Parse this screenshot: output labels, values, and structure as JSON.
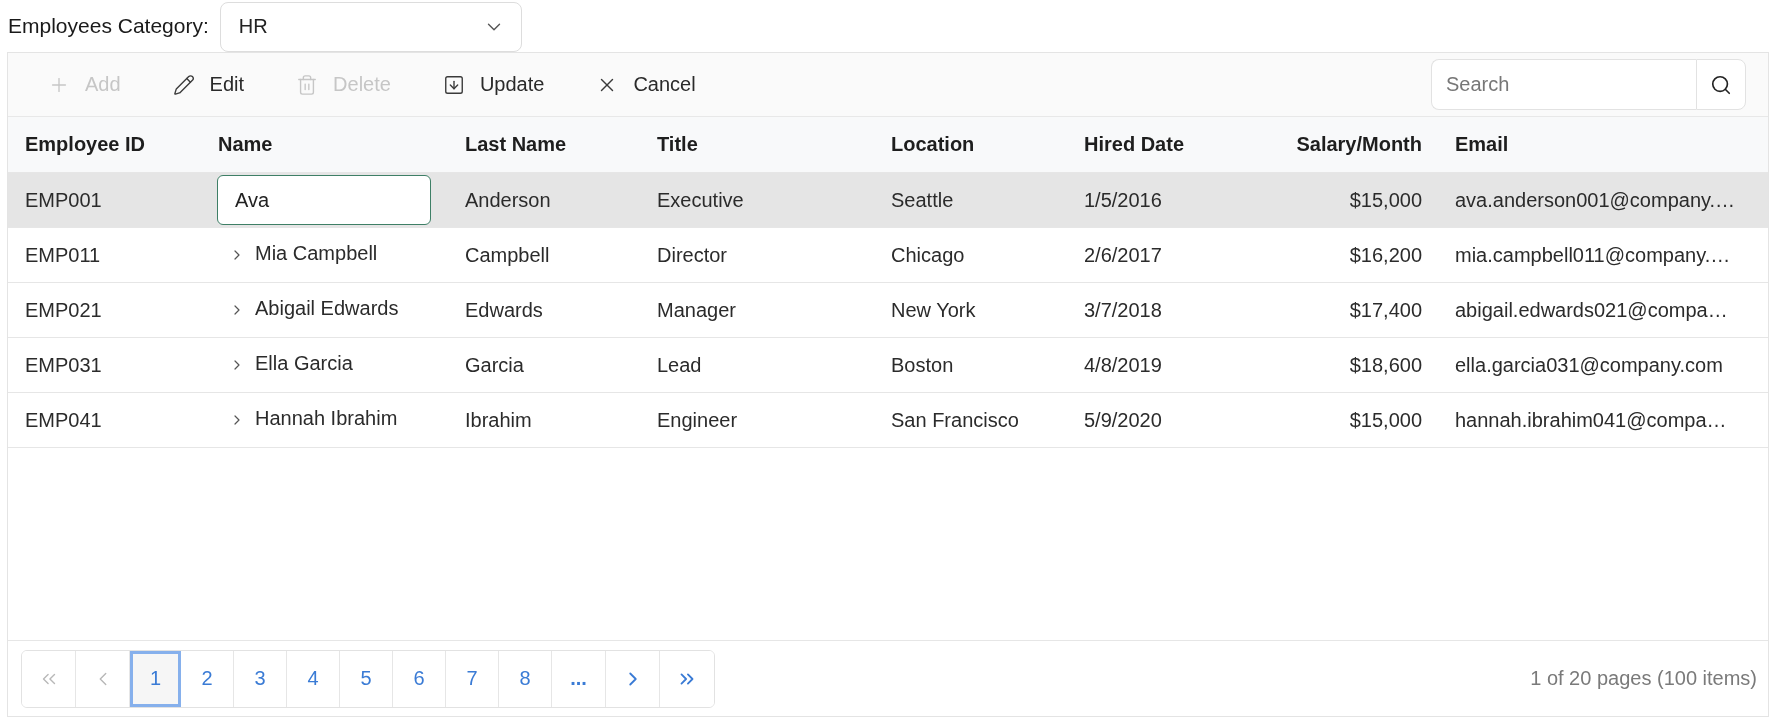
{
  "filter": {
    "label": "Employees Category:",
    "value": "HR"
  },
  "toolbar": {
    "items": [
      {
        "kind": "add",
        "label": "Add",
        "disabled": true
      },
      {
        "kind": "edit",
        "label": "Edit",
        "disabled": false
      },
      {
        "kind": "delete",
        "label": "Delete",
        "disabled": true
      },
      {
        "kind": "update",
        "label": "Update",
        "disabled": false
      },
      {
        "kind": "cancel",
        "label": "Cancel",
        "disabled": false
      }
    ],
    "search": {
      "placeholder": "Search"
    }
  },
  "table": {
    "columns": [
      {
        "label": "Employee ID",
        "kind": "text"
      },
      {
        "label": "Name",
        "kind": "text"
      },
      {
        "label": "Last Name",
        "kind": "text"
      },
      {
        "label": "Title",
        "kind": "text"
      },
      {
        "label": "Location",
        "kind": "text"
      },
      {
        "label": "Hired Date",
        "kind": "text"
      },
      {
        "label": "Salary/Month",
        "kind": "number"
      },
      {
        "label": "Email",
        "kind": "text"
      }
    ],
    "rows": [
      {
        "selected": true,
        "cells": [
          "EMP001",
          {
            "kind": "input",
            "value": "Ava"
          },
          "Anderson",
          "Executive",
          "Seattle",
          "1/5/2016",
          "$15,000",
          "ava.anderson001@company.…"
        ]
      },
      {
        "selected": false,
        "cells": [
          "EMP011",
          {
            "kind": "expander",
            "text": "Mia Campbell",
            "expanded": false
          },
          "Campbell",
          "Director",
          "Chicago",
          "2/6/2017",
          "$16,200",
          "mia.campbell011@company.…"
        ]
      },
      {
        "selected": false,
        "cells": [
          "EMP021",
          {
            "kind": "expander",
            "text": "Abigail Edwards",
            "expanded": false
          },
          "Edwards",
          "Manager",
          "New York",
          "3/7/2018",
          "$17,400",
          "abigail.edwards021@compa…"
        ]
      },
      {
        "selected": false,
        "cells": [
          "EMP031",
          {
            "kind": "expander",
            "text": "Ella Garcia",
            "expanded": false
          },
          "Garcia",
          "Lead",
          "Boston",
          "4/8/2019",
          "$18,600",
          "ella.garcia031@company.com"
        ]
      },
      {
        "selected": false,
        "cells": [
          "EMP041",
          {
            "kind": "expander",
            "text": "Hannah Ibrahim",
            "expanded": false
          },
          "Ibrahim",
          "Engineer",
          "San Francisco",
          "5/9/2020",
          "$15,000",
          "hannah.ibrahim041@compa…"
        ]
      }
    ]
  },
  "pager": {
    "first": {
      "disabled": true
    },
    "previous": {
      "disabled": true
    },
    "pages": [
      {
        "label": "1",
        "selected": true
      },
      {
        "label": "2",
        "selected": false
      },
      {
        "label": "3",
        "selected": false
      },
      {
        "label": "4",
        "selected": false
      },
      {
        "label": "5",
        "selected": false
      },
      {
        "label": "6",
        "selected": false
      },
      {
        "label": "7",
        "selected": false
      },
      {
        "label": "8",
        "selected": false
      }
    ],
    "more": "...",
    "next": {
      "disabled": false
    },
    "last": {
      "disabled": false
    },
    "info": "1 of 20 pages (100 items)"
  }
}
